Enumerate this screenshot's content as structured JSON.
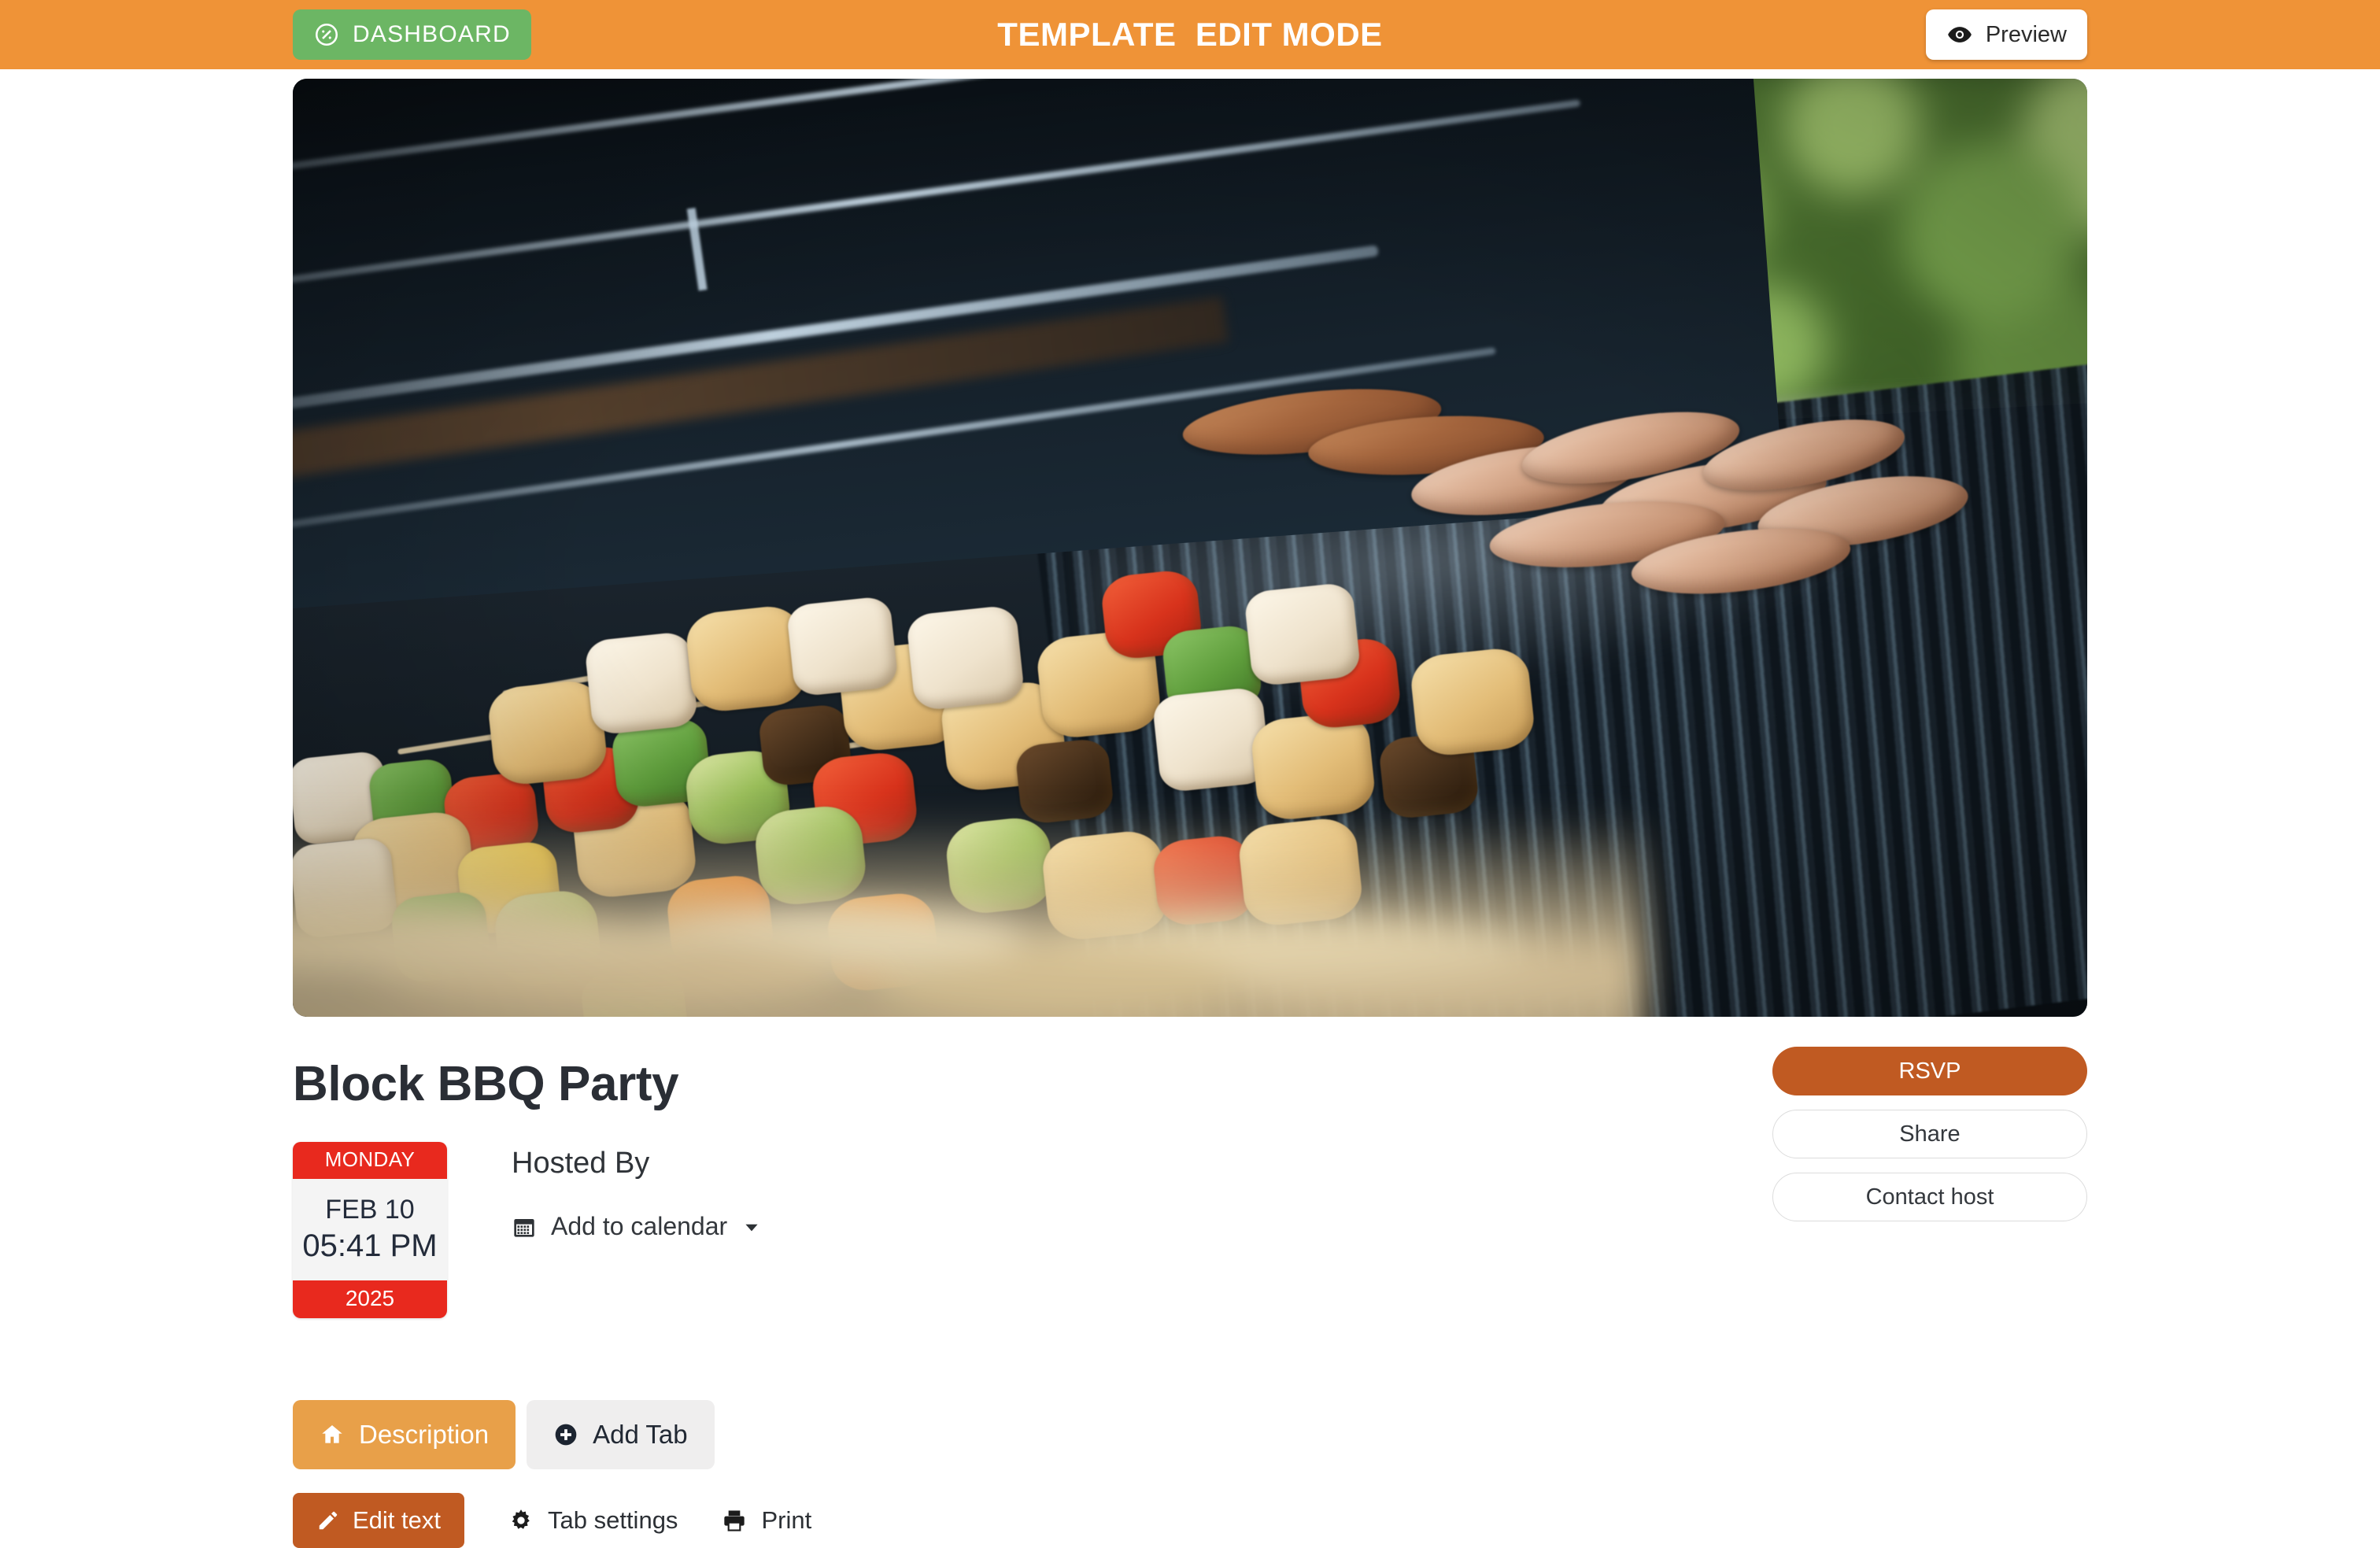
{
  "topbar": {
    "dashboard_label": "DASHBOARD",
    "dashboard_icon": "gauge-icon",
    "title": "TEMPLATE  EDIT MODE",
    "preview_label": "Preview",
    "preview_icon": "eye-icon",
    "background_color": "#ef9337",
    "dashboard_color": "#6cb664"
  },
  "hero": {
    "alt": "Kebab skewers and sausages grilling on an outdoor barbecue"
  },
  "event": {
    "title": "Block BBQ Party",
    "date_card": {
      "weekday": "MONDAY",
      "month_day": "FEB 10",
      "time": "05:41 PM",
      "year": "2025",
      "accent_color": "#e8291e"
    },
    "hosted_by_label": "Hosted By",
    "add_to_calendar": {
      "label": "Add to calendar",
      "icon": "calendar-icon",
      "caret_icon": "caret-down-icon"
    }
  },
  "actions": {
    "rsvp_label": "RSVP",
    "share_label": "Share",
    "contact_host_label": "Contact host",
    "rsvp_color": "#c05a22"
  },
  "tabs": [
    {
      "label": "Description",
      "icon": "home-icon",
      "active": true
    },
    {
      "label": "Add Tab",
      "icon": "plus-circle-icon",
      "active": false
    }
  ],
  "toolbar": [
    {
      "label": "Edit text",
      "icon": "pencil-icon",
      "primary": true
    },
    {
      "label": "Tab settings",
      "icon": "gear-icon",
      "primary": false
    },
    {
      "label": "Print",
      "icon": "printer-icon",
      "primary": false
    }
  ]
}
